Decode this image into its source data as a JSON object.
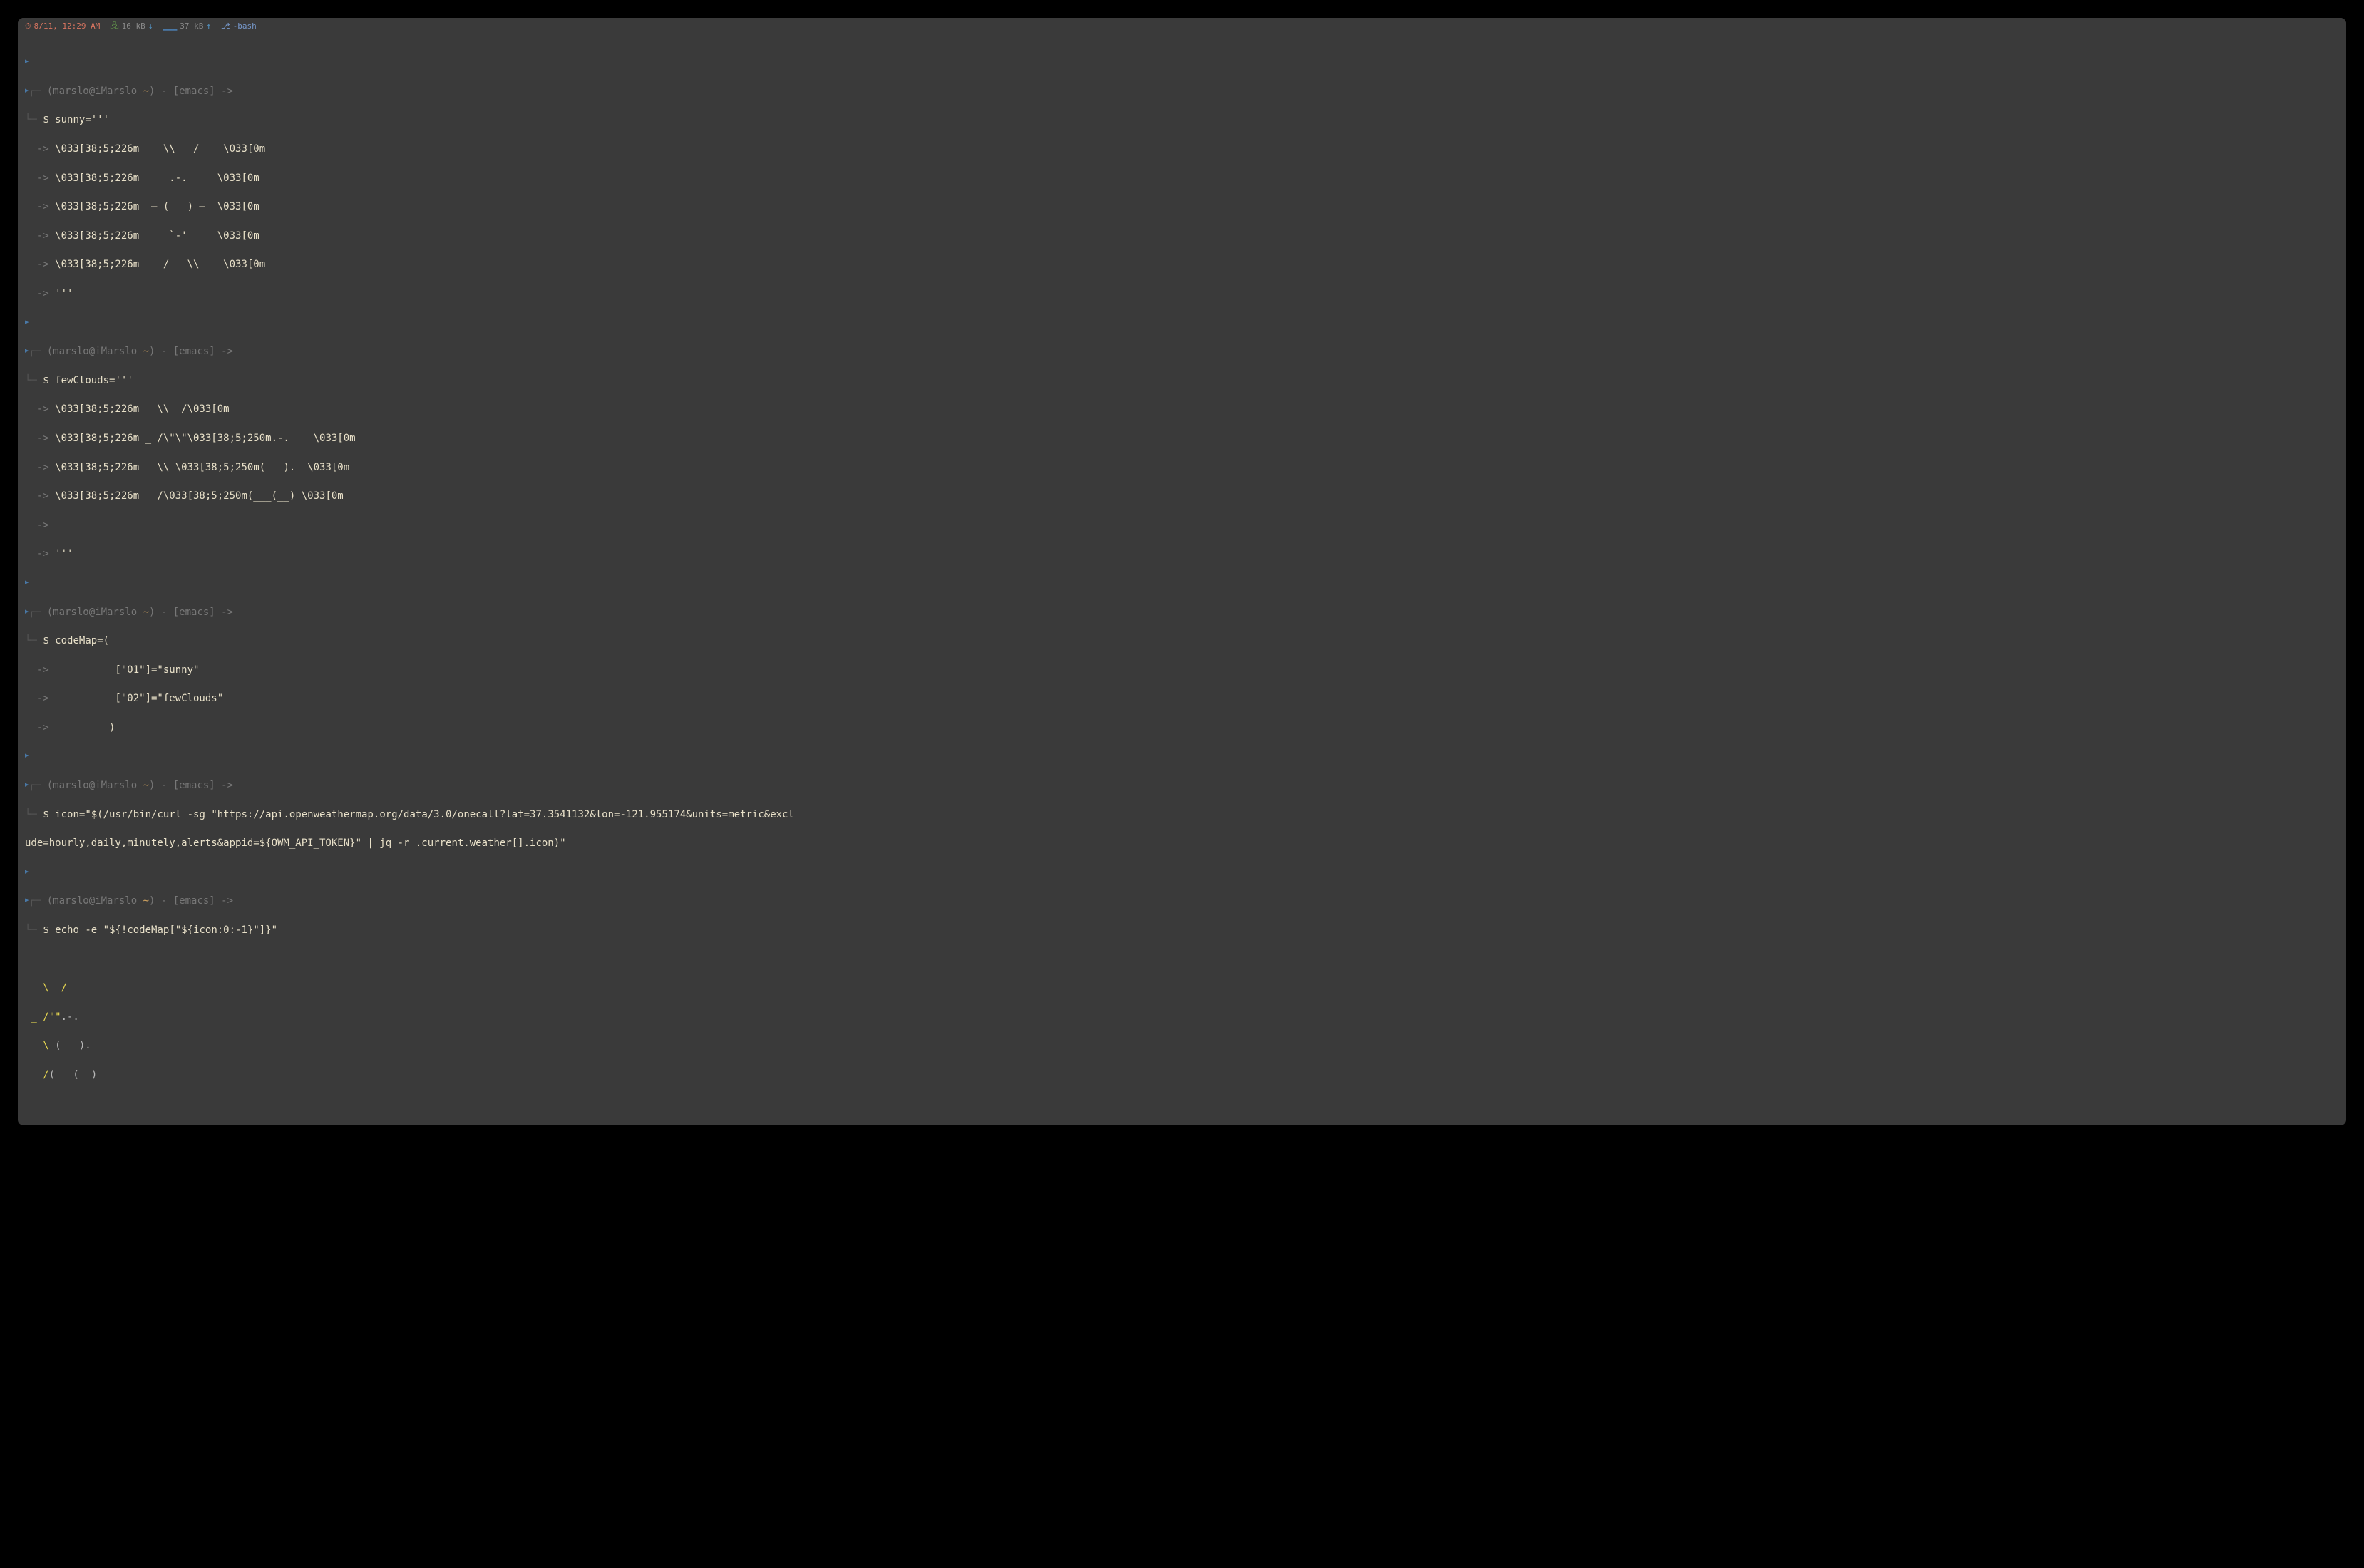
{
  "statusbar": {
    "time": "8/11, 12:29 AM",
    "net_down": "16 kB",
    "net_down_arrow": "↓",
    "net_up": "37 kB",
    "net_up_arrow": "↑",
    "process": "-bash"
  },
  "prompt": {
    "corner_top": "┌─",
    "corner_bot": "└─",
    "context": " (marslo@iMarslo ",
    "tilde": "~",
    "context_end": ") - [emacs] ->",
    "dollar": "$",
    "cont_arrow": "  ->"
  },
  "blocks": [
    {
      "command": "sunny='''",
      "continuations": [
        " \\033[38;5;226m    \\\\   /    \\033[0m",
        " \\033[38;5;226m     .-.     \\033[0m",
        " \\033[38;5;226m  ― (   ) ―  \\033[0m",
        " \\033[38;5;226m     `-'     \\033[0m",
        " \\033[38;5;226m    /   \\\\    \\033[0m",
        " '''"
      ]
    },
    {
      "command": "fewClouds='''",
      "continuations": [
        " \\033[38;5;226m   \\\\  /\\033[0m",
        " \\033[38;5;226m _ /\\\"\\\"\\033[38;5;250m.-.    \\033[0m",
        " \\033[38;5;226m   \\\\_\\033[38;5;250m(   ).  \\033[0m",
        " \\033[38;5;226m   /\\033[38;5;250m(___(__) \\033[0m",
        "",
        " '''"
      ]
    },
    {
      "command": "codeMap=(",
      "continuations": [
        "           [\"01\"]=\"sunny\"",
        "           [\"02\"]=\"fewClouds\"",
        "          )"
      ]
    },
    {
      "command": "icon=\"$(/usr/bin/curl -sg \"https://api.openweathermap.org/data/3.0/onecall?lat=37.3541132&lon=-121.955174&units=metric&excl",
      "wrapped": "ude=hourly,daily,minutely,alerts&appid=${OWM_API_TOKEN}\" | jq -r .current.weather[].icon)\"",
      "continuations": []
    },
    {
      "command": "echo -e \"${!codeMap[\"${icon:0:-1}\"]}\"",
      "continuations": []
    }
  ],
  "output": {
    "l1": "   \\  /",
    "l2a": " _ /\"\"",
    "l2b": ".-.",
    "l3a": "   \\_",
    "l3b": "(   ).",
    "l4a": "   /",
    "l4b": "(___(__)"
  }
}
